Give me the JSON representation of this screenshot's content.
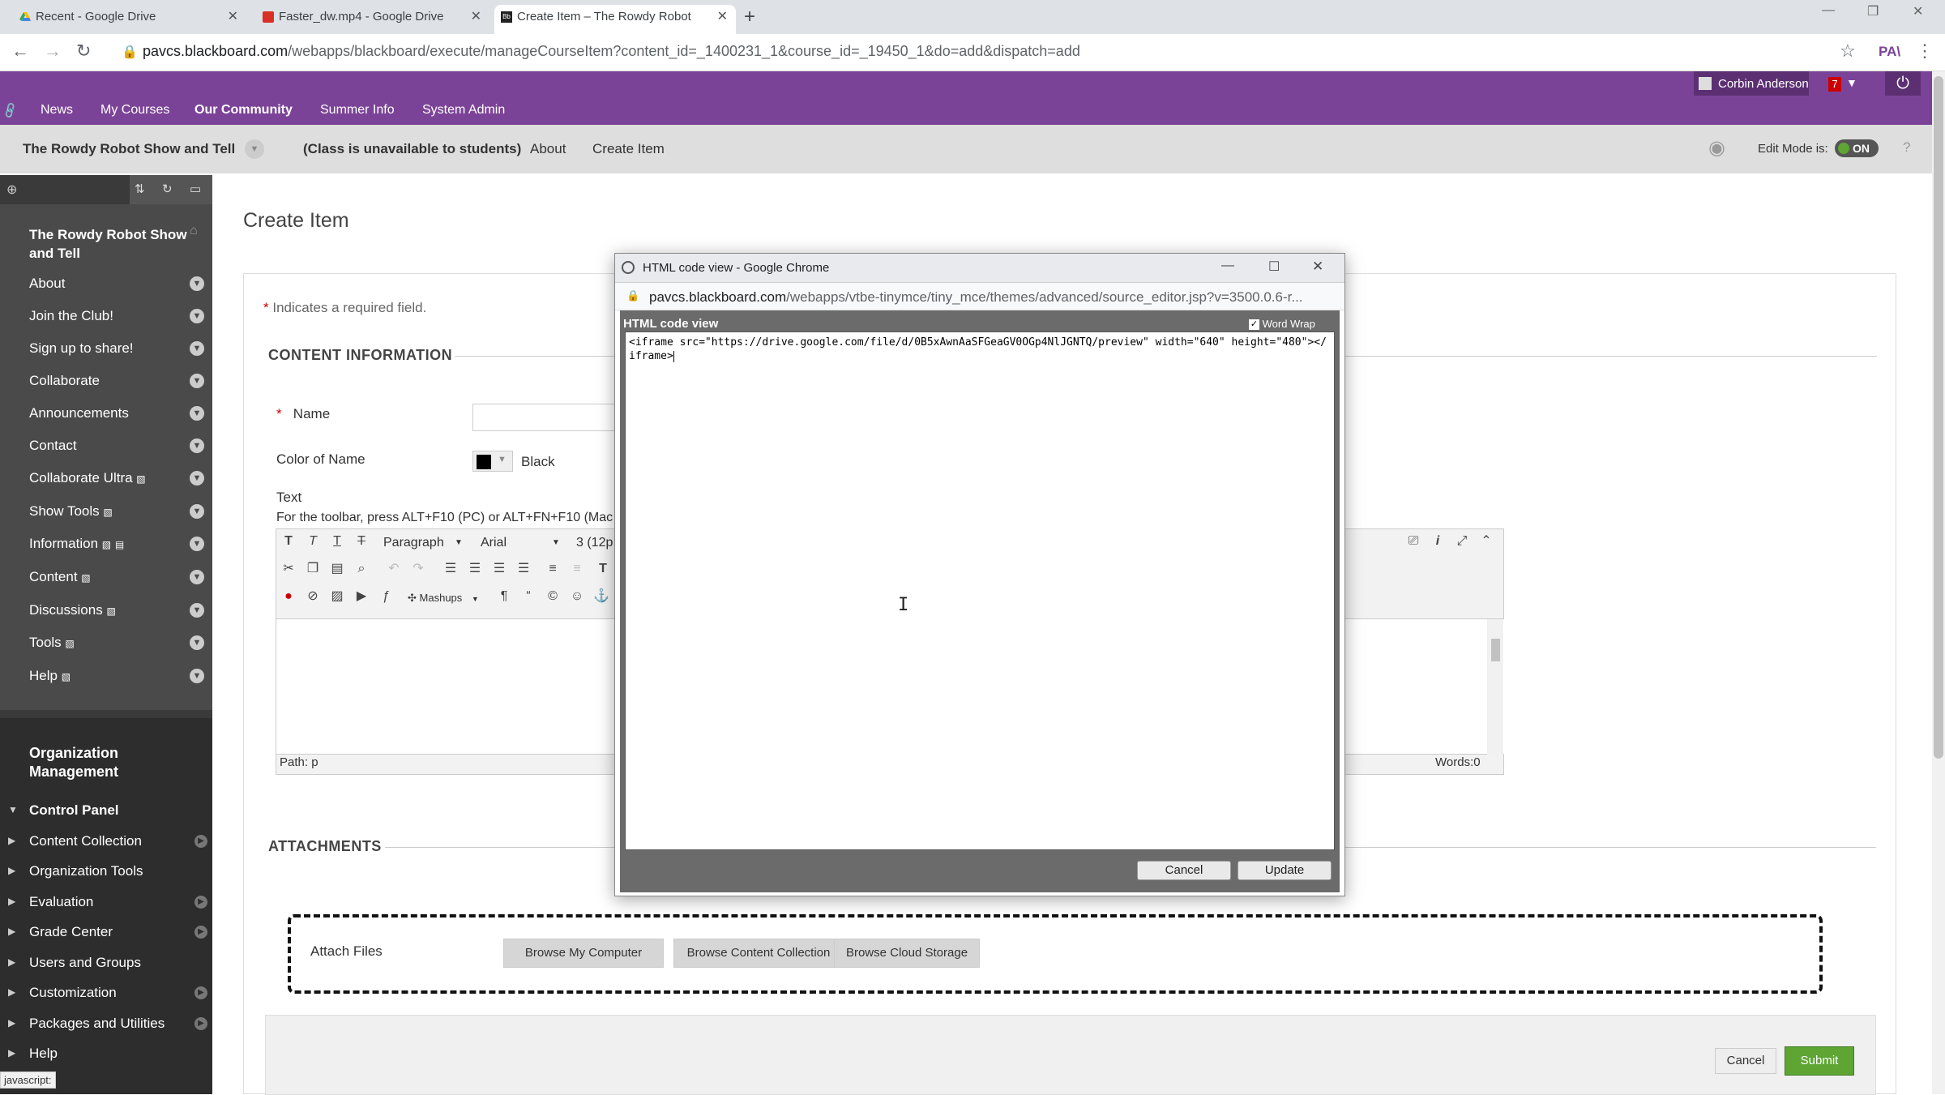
{
  "browser": {
    "tabs": [
      {
        "label": "Recent - Google Drive",
        "icon": "google-drive-icon"
      },
      {
        "label": "Faster_dw.mp4 - Google Drive",
        "icon": "video-file-icon"
      },
      {
        "label": "Create Item – The Rowdy Robot",
        "icon": "blackboard-icon"
      }
    ],
    "url_host": "pavcs.blackboard.com",
    "url_path": "/webapps/blackboard/execute/manageCourseItem?content_id=_1400231_1&course_id=_19450_1&do=add&dispatch=add",
    "profile": "PA\\"
  },
  "topnav": {
    "items": [
      "News",
      "My Courses",
      "Our Community",
      "Summer Info",
      "System Admin"
    ],
    "user_name": "Corbin Anderson",
    "notif_count": "7"
  },
  "coursebar": {
    "course_name": "The Rowdy Robot Show and Tell",
    "unavailable": "(Class is unavailable to students)",
    "crumb_about": "About",
    "crumb_current": "Create Item",
    "edit_mode_label": "Edit Mode is:",
    "edit_mode_value": "ON"
  },
  "sidebar": {
    "course_title": "The Rowdy Robot Show and Tell",
    "menu": [
      "About",
      "Join the Club!",
      "Sign up to share!",
      "Collaborate",
      "Announcements",
      "Contact",
      "Collaborate Ultra",
      "Show Tools",
      "Information",
      "Content",
      "Discussions",
      "Tools",
      "Help"
    ],
    "org_title": "Organization Management",
    "control_panel": "Control Panel",
    "cp_items": [
      "Content Collection",
      "Organization Tools",
      "Evaluation",
      "Grade Center",
      "Users and Groups",
      "Customization",
      "Packages and Utilities",
      "Help"
    ]
  },
  "main": {
    "title": "Create Item",
    "required_note": "Indicates a required field.",
    "content_info": "CONTENT INFORMATION",
    "name_label": "Name",
    "color_label": "Color of Name",
    "color_value": "Black",
    "text_label": "Text",
    "toolbar_hint": "For the toolbar, press ALT+F10 (PC) or ALT+FN+F10 (Mac",
    "paragraph": "Paragraph",
    "font": "Arial",
    "size": "3 (12p",
    "mashups": "Mashups",
    "path": "Path: p",
    "words": "Words:0",
    "attachments": "ATTACHMENTS",
    "attach_files": "Attach Files",
    "browse_computer": "Browse My Computer",
    "browse_content": "Browse Content Collection",
    "browse_cloud": "Browse Cloud Storage",
    "cancel": "Cancel",
    "submit": "Submit"
  },
  "dialog": {
    "window_title": "HTML code view - Google Chrome",
    "url_host": "pavcs.blackboard.com",
    "url_path": "/webapps/vtbe-tinymce/tiny_mce/themes/advanced/source_editor.jsp?v=3500.0.6-r...",
    "header": "HTML code view",
    "word_wrap": "Word Wrap",
    "code": "<iframe src=\"https://drive.google.com/file/d/0B5xAwnAaSFGeaGV0OGp4NlJGNTQ/preview\" width=\"640\" height=\"480\"></iframe>",
    "cancel": "Cancel",
    "update": "Update"
  },
  "status_bar": "javascript:",
  "colors": {
    "purple": "#7b4397",
    "submit_green": "#5ea534",
    "edit_on": "#5ea534"
  }
}
